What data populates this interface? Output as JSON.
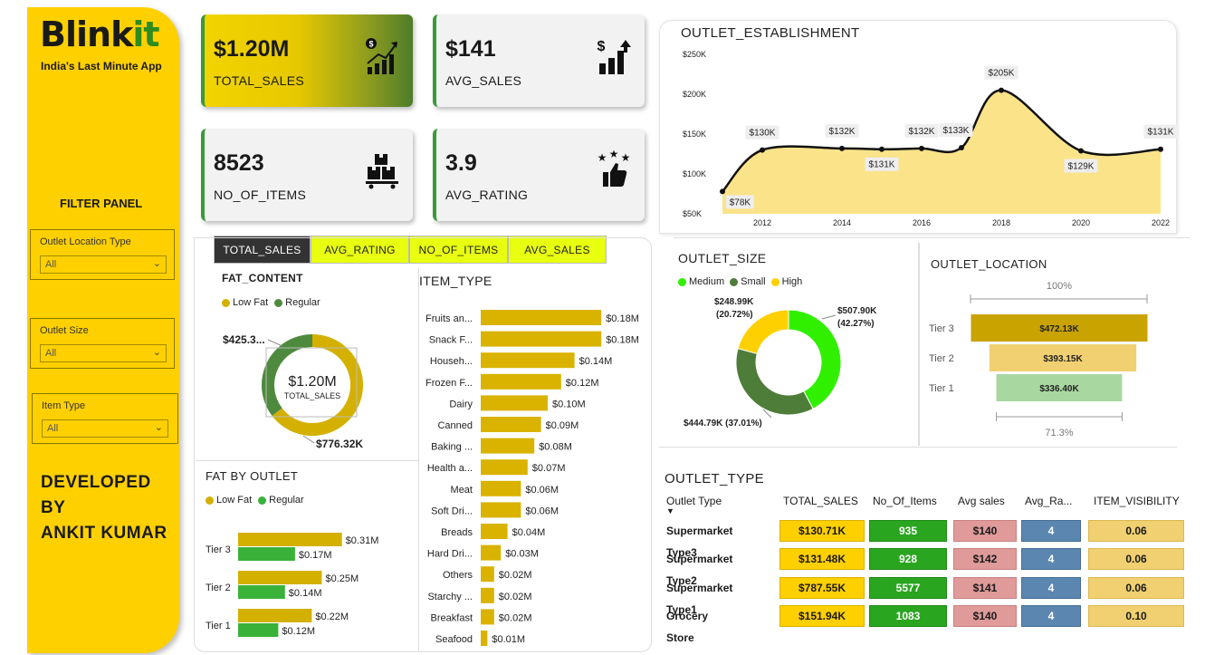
{
  "sidebar": {
    "logo_main": "Blink",
    "logo_accent": "it",
    "tagline": "India's Last Minute App",
    "filter_title": "FILTER PANEL",
    "slicers": [
      {
        "label": "Outlet Location Type",
        "value": "All"
      },
      {
        "label": "Outlet Size",
        "value": "All"
      },
      {
        "label": "Item Type",
        "value": "All"
      }
    ],
    "developer_line1": "DEVELOPED BY",
    "developer_line2": "ANKIT KUMAR"
  },
  "kpis": [
    {
      "value": "$1.20M",
      "name": "TOTAL_SALES",
      "icon": "dollar-growth-chart-icon"
    },
    {
      "value": "$141",
      "name": "AVG_SALES",
      "icon": "dollar-bar-chart-icon"
    },
    {
      "value": "8523",
      "name": "NO_OF_ITEMS",
      "icon": "boxes-cart-icon"
    },
    {
      "value": "3.9",
      "name": "AVG_RATING",
      "icon": "thumbs-up-stars-icon"
    }
  ],
  "tabs": [
    "TOTAL_SALES",
    "AVG_RATING",
    "NO_OF_ITEMS",
    "AVG_SALES"
  ],
  "colors": {
    "gold": "#d4b000",
    "green": "#4e8a3e",
    "bright_green": "#3ab23a",
    "yellow": "#ffd000",
    "lime": "#30f000"
  },
  "fat_content": {
    "title": "FAT_CONTENT",
    "legend": [
      "Low Fat",
      "Regular"
    ],
    "center_value": "$1.20M",
    "center_label": "TOTAL_SALES",
    "label_low_fat": "$776.32K",
    "label_regular": "$425.3..."
  },
  "fat_by_outlet": {
    "title": "FAT BY OUTLET",
    "legend": [
      "Low Fat",
      "Regular"
    ]
  },
  "item_type": {
    "title": "ITEM_TYPE"
  },
  "outlet_establishment": {
    "title": "OUTLET_ESTABLISHMENT"
  },
  "outlet_size": {
    "title": "OUTLET_SIZE",
    "legend": [
      "Medium",
      "Small",
      "High"
    ],
    "label_medium": "$507.90K",
    "label_medium_pct": "(42.27%)",
    "label_small": "$444.79K (37.01%)",
    "label_high": "$248.99K",
    "label_high_pct": "(20.72%)"
  },
  "outlet_location": {
    "title": "OUTLET_LOCATION",
    "top_pct": "100%",
    "bottom_pct": "71.3%"
  },
  "outlet_type": {
    "title": "OUTLET_TYPE",
    "headers": [
      "Outlet Type",
      "TOTAL_SALES",
      "No_Of_Items",
      "Avg sales",
      "Avg_Ra...",
      "ITEM_VISIBILITY"
    ],
    "rows": [
      {
        "name": "Supermarket Type3",
        "sales": "$130.71K",
        "items": "935",
        "avg": "$140",
        "rating": "4",
        "vis": "0.06"
      },
      {
        "name": "Supermarket Type2",
        "sales": "$131.48K",
        "items": "928",
        "avg": "$142",
        "rating": "4",
        "vis": "0.06"
      },
      {
        "name": "Supermarket Type1",
        "sales": "$787.55K",
        "items": "5577",
        "avg": "$141",
        "rating": "4",
        "vis": "0.06"
      },
      {
        "name": "Grocery Store",
        "sales": "$151.94K",
        "items": "1083",
        "avg": "$140",
        "rating": "4",
        "vis": "0.10"
      }
    ]
  },
  "chart_data": [
    {
      "type": "pie",
      "title": "FAT_CONTENT",
      "categories": [
        "Low Fat",
        "Regular"
      ],
      "values": [
        776.32,
        425.36
      ],
      "unit": "K"
    },
    {
      "type": "bar",
      "title": "FAT BY OUTLET",
      "orientation": "horizontal",
      "categories": [
        "Tier 3",
        "Tier 2",
        "Tier 1"
      ],
      "series": [
        {
          "name": "Low Fat",
          "values": [
            0.31,
            0.25,
            0.22
          ],
          "labels": [
            "$0.31M",
            "$0.25M",
            "$0.22M"
          ]
        },
        {
          "name": "Regular",
          "values": [
            0.17,
            0.14,
            0.12
          ],
          "labels": [
            "$0.17M",
            "$0.14M",
            "$0.12M"
          ]
        }
      ],
      "unit": "M"
    },
    {
      "type": "bar",
      "title": "ITEM_TYPE",
      "orientation": "horizontal",
      "categories": [
        "Fruits an...",
        "Snack F...",
        "Househ...",
        "Frozen F...",
        "Dairy",
        "Canned",
        "Baking ...",
        "Health a...",
        "Meat",
        "Soft Dri...",
        "Breads",
        "Hard Dri...",
        "Others",
        "Starchy ...",
        "Breakfast",
        "Seafood"
      ],
      "values": [
        0.18,
        0.18,
        0.14,
        0.12,
        0.1,
        0.09,
        0.08,
        0.07,
        0.06,
        0.06,
        0.04,
        0.03,
        0.02,
        0.02,
        0.02,
        0.01
      ],
      "labels": [
        "$0.18M",
        "$0.18M",
        "$0.14M",
        "$0.12M",
        "$0.10M",
        "$0.09M",
        "$0.08M",
        "$0.07M",
        "$0.06M",
        "$0.06M",
        "$0.04M",
        "$0.03M",
        "$0.02M",
        "$0.02M",
        "$0.02M",
        "$0.01M"
      ],
      "unit": "M"
    },
    {
      "type": "area",
      "title": "OUTLET_ESTABLISHMENT",
      "x": [
        2011,
        2012,
        2014,
        2015,
        2016,
        2017,
        2018,
        2020,
        2022
      ],
      "values": [
        78,
        130,
        132,
        131,
        132,
        133,
        205,
        129,
        131
      ],
      "labels": [
        "$78K",
        "$130K",
        "$132K",
        "$131K",
        "$132K",
        "$133K",
        "$205K",
        "$129K",
        "$131K"
      ],
      "xticks": [
        2012,
        2014,
        2016,
        2018,
        2020,
        2022
      ],
      "yticks": [
        "$50K",
        "$100K",
        "$150K",
        "$200K",
        "$250K"
      ],
      "ylim": [
        50,
        250
      ],
      "unit": "K"
    },
    {
      "type": "pie",
      "title": "OUTLET_SIZE",
      "categories": [
        "Medium",
        "Small",
        "High"
      ],
      "values": [
        507.9,
        444.79,
        248.99
      ],
      "percent": [
        42.27,
        37.01,
        20.72
      ],
      "unit": "K"
    },
    {
      "type": "bar",
      "title": "OUTLET_LOCATION",
      "subtype": "funnel",
      "categories": [
        "Tier 3",
        "Tier 2",
        "Tier 1"
      ],
      "values": [
        472.13,
        393.15,
        336.4
      ],
      "labels": [
        "$472.13K",
        "$393.15K",
        "$336.40K"
      ],
      "unit": "K"
    }
  ]
}
